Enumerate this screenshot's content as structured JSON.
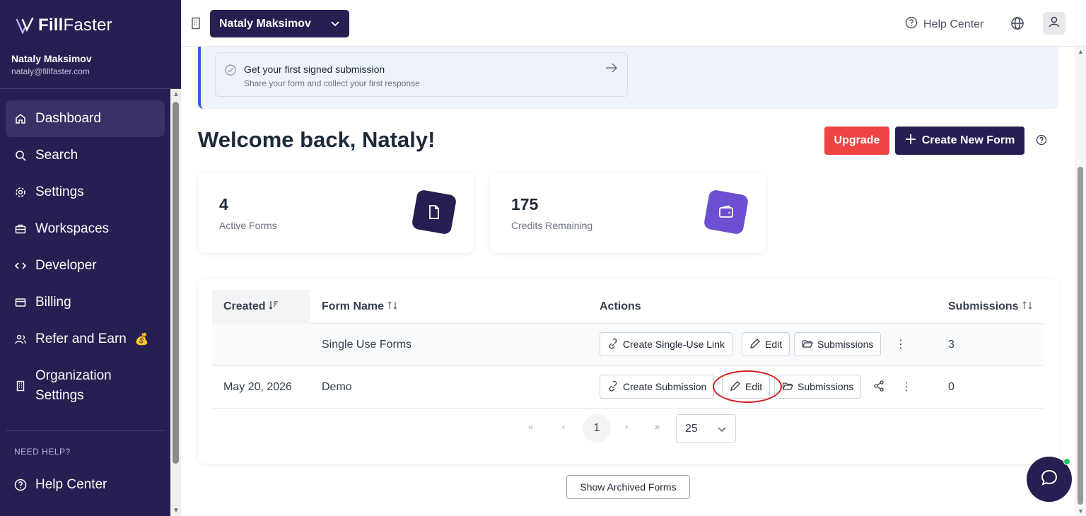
{
  "brand": {
    "name_bold": "Fill",
    "name_rest": "Faster"
  },
  "user": {
    "name": "Nataly Maksimov",
    "email": "nataly@fillfaster.com"
  },
  "sidebar": {
    "items": [
      {
        "label": "Dashboard",
        "icon": "home-icon",
        "active": true
      },
      {
        "label": "Search",
        "icon": "search-icon"
      },
      {
        "label": "Settings",
        "icon": "gear-icon"
      },
      {
        "label": "Workspaces",
        "icon": "briefcase-icon"
      },
      {
        "label": "Developer",
        "icon": "code-icon"
      },
      {
        "label": "Billing",
        "icon": "credit-card-icon"
      },
      {
        "label": "Refer and Earn",
        "icon": "users-icon",
        "badge": "💰"
      },
      {
        "label": "Organization Settings",
        "icon": "building-icon"
      }
    ],
    "need_help": "NEED HELP?",
    "help_center": "Help Center"
  },
  "topbar": {
    "org_name": "Nataly Maksimov",
    "help_center": "Help Center"
  },
  "banner": {
    "title": "Get your first signed submission",
    "subtitle": "Share your form and collect your first response"
  },
  "main": {
    "welcome": "Welcome back, Nataly!",
    "upgrade": "Upgrade",
    "create_new_form": "Create New Form"
  },
  "stats": [
    {
      "value": "4",
      "label": "Active Forms",
      "color": "#271e52"
    },
    {
      "value": "175",
      "label": "Credits Remaining",
      "color": "#6d4fd1"
    }
  ],
  "table": {
    "headers": {
      "created": "Created",
      "form_name": "Form Name",
      "actions": "Actions",
      "submissions": "Submissions"
    },
    "rows": [
      {
        "created": "",
        "form_name": "Single Use Forms",
        "primary_action": "Create Single-Use Link",
        "edit": "Edit",
        "submissions_btn": "Submissions",
        "submissions": "3"
      },
      {
        "created": "May 20, 2026",
        "form_name": "Demo",
        "primary_action": "Create Submission",
        "edit": "Edit",
        "submissions_btn": "Submissions",
        "submissions": "0"
      }
    ]
  },
  "pagination": {
    "current_page": "1",
    "page_size": "25"
  },
  "archived_button": "Show Archived Forms",
  "colors": {
    "brand": "#271e52",
    "upgrade": "#ef4444",
    "annotation": "#d11d1d"
  }
}
